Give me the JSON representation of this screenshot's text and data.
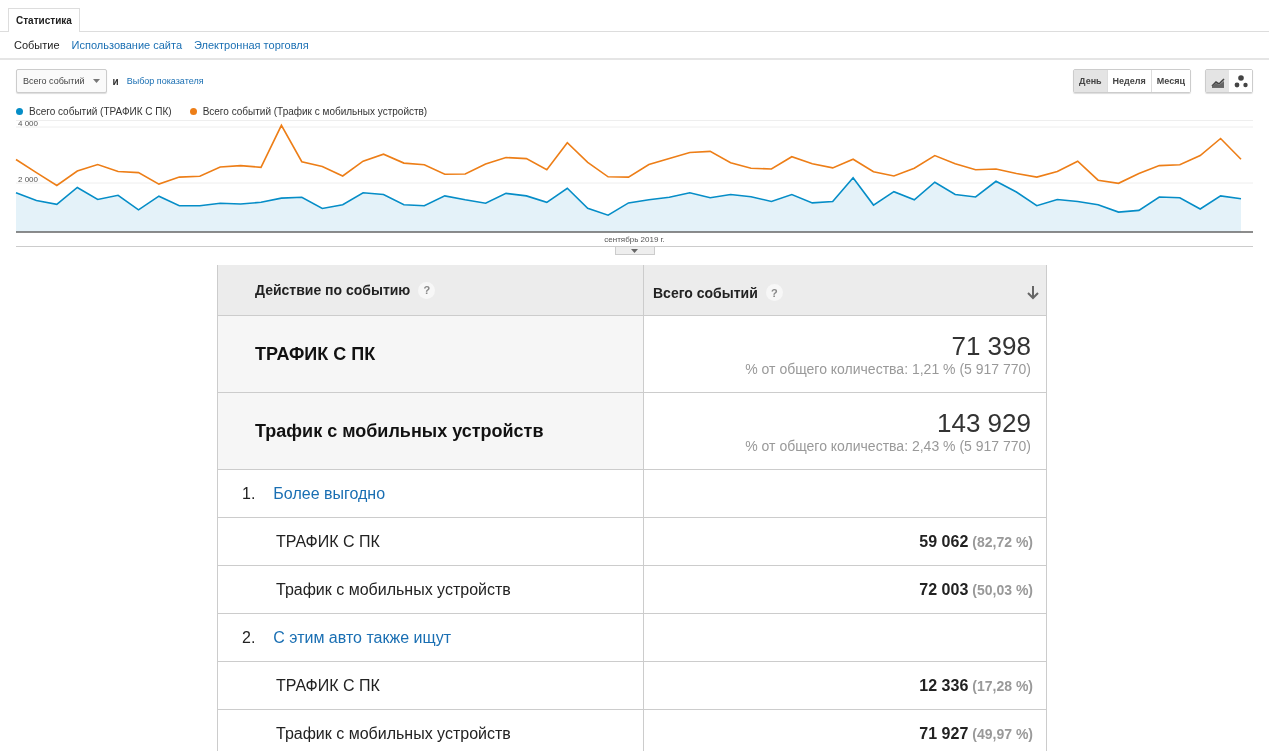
{
  "tabs": [
    {
      "label": "Статистика",
      "selected": true
    }
  ],
  "subnav": [
    {
      "label": "Событие",
      "selected": true
    },
    {
      "label": "Использование сайта",
      "selected": false
    },
    {
      "label": "Электронная торговля",
      "selected": false
    }
  ],
  "metric_select": {
    "value": "Всего событий"
  },
  "conjunction": "и",
  "metric_link": "Выбор показателя",
  "period_buttons": [
    {
      "label": "День",
      "selected": true
    },
    {
      "label": "Неделя",
      "selected": false
    },
    {
      "label": "Месяц",
      "selected": false
    }
  ],
  "chart_type_buttons": [
    {
      "kind": "line",
      "selected": true
    },
    {
      "kind": "motion",
      "selected": false
    }
  ],
  "chart": {
    "chart_data": {
      "type": "line",
      "ylim": [
        250,
        4250
      ],
      "yticks": [
        {
          "value": 2000,
          "label": "2 000"
        },
        {
          "value": 4000,
          "label": "4 000"
        }
      ],
      "series": [
        {
          "name": "Всего событий (ТРАФИК С ПК)",
          "color": "#058dc7",
          "values": [
            1650,
            1370,
            1240,
            1840,
            1410,
            1560,
            1040,
            1530,
            1190,
            1190,
            1280,
            1250,
            1310,
            1460,
            1490,
            1090,
            1220,
            1650,
            1590,
            1220,
            1190,
            1540,
            1400,
            1280,
            1630,
            1540,
            1310,
            1810,
            1100,
            850,
            1290,
            1400,
            1490,
            1650,
            1470,
            1590,
            1510,
            1340,
            1590,
            1290,
            1340,
            2190,
            1210,
            1690,
            1400,
            2030,
            1590,
            1500,
            2060,
            1680,
            1190,
            1410,
            1340,
            1220,
            960,
            1020,
            1500,
            1470,
            1070,
            1540,
            1440
          ]
        },
        {
          "name": "Всего событий (Трафик с мобильных устройств)",
          "color": "#ed7e17",
          "values": [
            2840,
            2370,
            1910,
            2430,
            2660,
            2410,
            2370,
            1960,
            2210,
            2240,
            2570,
            2620,
            2560,
            4060,
            2760,
            2590,
            2250,
            2780,
            3030,
            2710,
            2650,
            2310,
            2320,
            2680,
            2910,
            2870,
            2470,
            3440,
            2740,
            2220,
            2210,
            2660,
            2880,
            3090,
            3130,
            2720,
            2530,
            2500,
            2940,
            2690,
            2540,
            2850,
            2400,
            2250,
            2530,
            2980,
            2690,
            2470,
            2500,
            2340,
            2210,
            2410,
            2780,
            2100,
            1990,
            2340,
            2620,
            2650,
            2980,
            3590,
            2850
          ]
        }
      ]
    },
    "period_label": "сентябрь 2019 г."
  },
  "table": {
    "columns": [
      {
        "label": "Действие по событию",
        "help": "?",
        "sorted": false
      },
      {
        "label": "Всего событий",
        "help": "?",
        "sorted": true
      }
    ],
    "rows": [
      {
        "kind": "total",
        "label": "ТРАФИК С ПК",
        "value": "71 398",
        "share": "% от общего количества: 1,21 % (5 917 770)"
      },
      {
        "kind": "total",
        "label": "Трафик с мобильных устройств",
        "value": "143 929",
        "share": "% от общего количества: 2,43 % (5 917 770)"
      },
      {
        "kind": "group",
        "index": "1.",
        "label": "Более выгодно"
      },
      {
        "kind": "sub",
        "label": "ТРАФИК С ПК",
        "value": "59 062",
        "percent": "(82,72 %)"
      },
      {
        "kind": "sub",
        "label": "Трафик с мобильных устройств",
        "value": "72 003",
        "percent": "(50,03 %)"
      },
      {
        "kind": "group",
        "index": "2.",
        "label": "С этим авто также ищут"
      },
      {
        "kind": "sub",
        "label": "ТРАФИК С ПК",
        "value": "12 336",
        "percent": "(17,28 %)"
      },
      {
        "kind": "sub",
        "label": "Трафик с мобильных устройств",
        "value": "71 927",
        "percent": "(49,97 %)"
      }
    ]
  }
}
